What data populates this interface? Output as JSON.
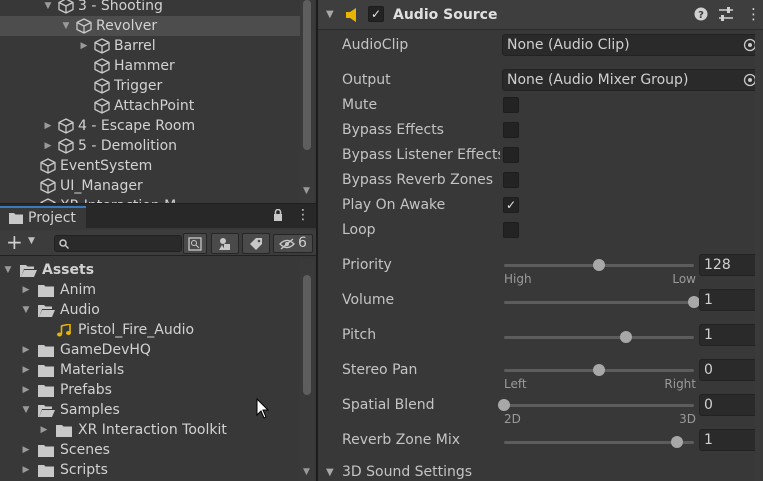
{
  "hierarchy": {
    "items": [
      {
        "label": "3 - Shooting",
        "depth": 2,
        "fold": "open"
      },
      {
        "label": "Revolver",
        "depth": 3,
        "fold": "open",
        "selected": true
      },
      {
        "label": "Barrel",
        "depth": 4,
        "fold": "closed"
      },
      {
        "label": "Hammer",
        "depth": 4,
        "fold": "none"
      },
      {
        "label": "Trigger",
        "depth": 4,
        "fold": "none"
      },
      {
        "label": "AttachPoint",
        "depth": 4,
        "fold": "none"
      },
      {
        "label": "4 - Escape Room",
        "depth": 2,
        "fold": "closed"
      },
      {
        "label": "5 - Demolition",
        "depth": 2,
        "fold": "closed"
      },
      {
        "label": "EventSystem",
        "depth": 1,
        "fold": "none"
      },
      {
        "label": "UI_Manager",
        "depth": 1,
        "fold": "none"
      },
      {
        "label": "XR Interaction M...",
        "depth": 1,
        "fold": "none"
      }
    ]
  },
  "project": {
    "tab_label": "Project",
    "add_label": "+",
    "search_placeholder": "",
    "hidden_count": "6",
    "tree": [
      {
        "label": "Assets",
        "depth": 0,
        "fold": "open",
        "bold": true,
        "kind": "folder-open"
      },
      {
        "label": "Anim",
        "depth": 1,
        "fold": "closed",
        "kind": "folder"
      },
      {
        "label": "Audio",
        "depth": 1,
        "fold": "open",
        "kind": "folder-open"
      },
      {
        "label": "Pistol_Fire_Audio",
        "depth": 2,
        "fold": "none",
        "kind": "audio"
      },
      {
        "label": "GameDevHQ",
        "depth": 1,
        "fold": "closed",
        "kind": "folder"
      },
      {
        "label": "Materials",
        "depth": 1,
        "fold": "closed",
        "kind": "folder"
      },
      {
        "label": "Prefabs",
        "depth": 1,
        "fold": "closed",
        "kind": "folder"
      },
      {
        "label": "Samples",
        "depth": 1,
        "fold": "open",
        "kind": "folder-open"
      },
      {
        "label": "XR Interaction Toolkit",
        "depth": 2,
        "fold": "closed",
        "kind": "folder"
      },
      {
        "label": "Scenes",
        "depth": 1,
        "fold": "closed",
        "kind": "folder"
      },
      {
        "label": "Scripts",
        "depth": 1,
        "fold": "closed",
        "kind": "folder"
      }
    ]
  },
  "inspector": {
    "component_title": "Audio Source",
    "component_enabled": true,
    "audio_clip": {
      "label": "AudioClip",
      "value": "None (Audio Clip)"
    },
    "output": {
      "label": "Output",
      "value": "None (Audio Mixer Group)"
    },
    "toggles": [
      {
        "label": "Mute",
        "checked": false
      },
      {
        "label": "Bypass Effects",
        "checked": false
      },
      {
        "label": "Bypass Listener Effects",
        "checked": false
      },
      {
        "label": "Bypass Reverb Zones",
        "checked": false
      },
      {
        "label": "Play On Awake",
        "checked": true
      },
      {
        "label": "Loop",
        "checked": false
      }
    ],
    "sliders": [
      {
        "label": "Priority",
        "value": "128",
        "fraction": 0.5,
        "min_label": "High",
        "max_label": "Low"
      },
      {
        "label": "Volume",
        "value": "1",
        "fraction": 1.0
      },
      {
        "label": "Pitch",
        "value": "1",
        "fraction": 0.64
      },
      {
        "label": "Stereo Pan",
        "value": "0",
        "fraction": 0.5,
        "min_label": "Left",
        "max_label": "Right"
      },
      {
        "label": "Spatial Blend",
        "value": "0",
        "fraction": 0.0,
        "min_label": "2D",
        "max_label": "3D"
      },
      {
        "label": "Reverb Zone Mix",
        "value": "1",
        "fraction": 0.91
      }
    ],
    "section_3d": "3D Sound Settings"
  },
  "colors": {
    "accent": "#3a79bb",
    "audio_icon": "#e8b400"
  }
}
